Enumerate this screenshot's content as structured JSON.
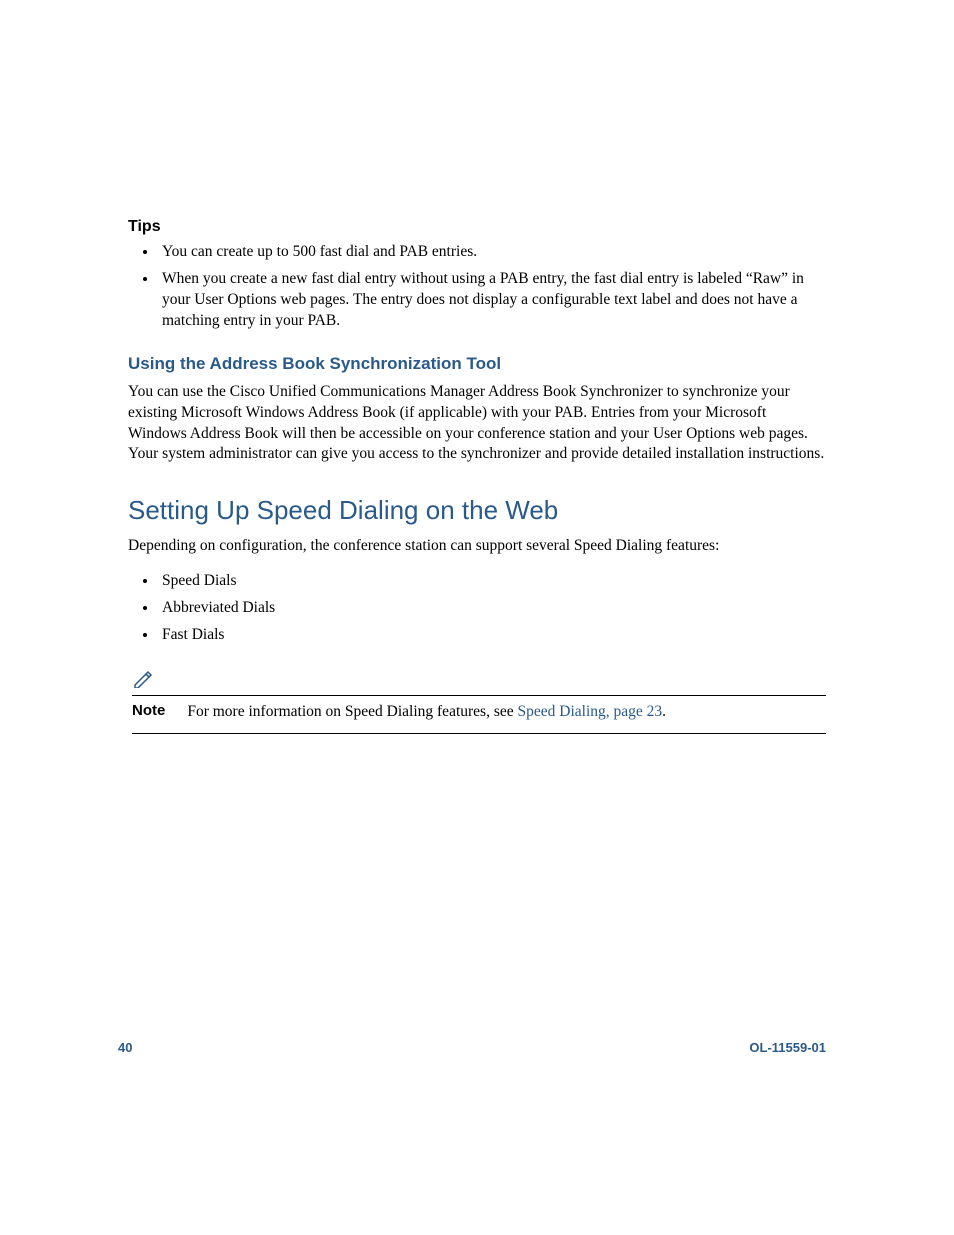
{
  "tips": {
    "heading": "Tips",
    "items": [
      "You can create up to 500 fast dial and PAB entries.",
      "When you create a new fast dial entry without using a PAB entry, the fast dial entry is labeled “Raw” in your User Options web pages. The entry does not display a configurable text label and does not have a matching entry in your PAB."
    ]
  },
  "subsection": {
    "heading": "Using the Address Book Synchronization Tool",
    "para": "You can use the Cisco Unified Communications Manager Address Book Synchronizer to synchronize your existing Microsoft Windows Address Book (if applicable) with your PAB. Entries from your Microsoft Windows Address Book will then be accessible on your conference station and your User Options web pages. Your system administrator can give you access to the synchronizer and provide detailed installation instructions."
  },
  "section": {
    "heading": "Setting Up Speed Dialing on the Web",
    "intro": "Depending on configuration, the conference station can support several Speed Dialing features:",
    "items": [
      "Speed Dials",
      "Abbreviated Dials",
      "Fast Dials"
    ]
  },
  "note": {
    "label": "Note",
    "text_before": "For more information on Speed Dialing features, see ",
    "link_text": "Speed Dialing, page 23",
    "text_after": "."
  },
  "footer": {
    "page_number": "40",
    "doc_id": "OL-11559-01"
  }
}
